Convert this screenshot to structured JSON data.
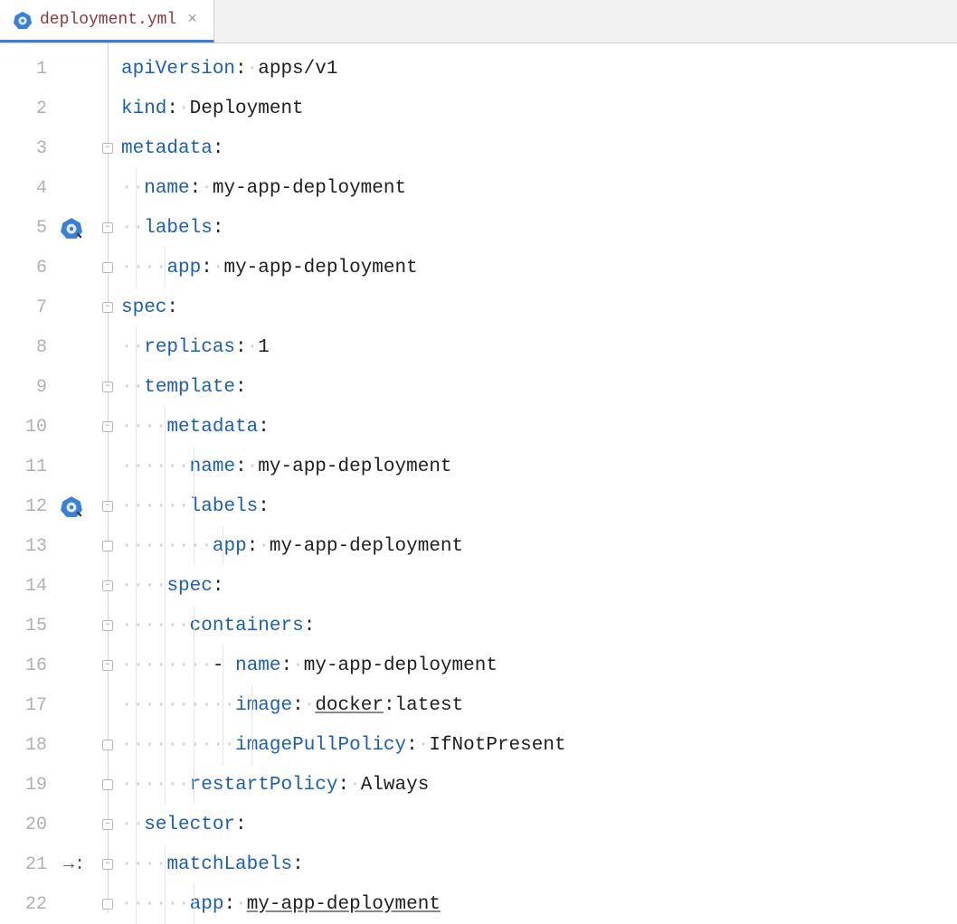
{
  "tab": {
    "filename": "deployment.yml",
    "icon": "kubernetes-icon",
    "close_glyph": "×"
  },
  "gutter": {
    "k8s_marker_lines": [
      5,
      12
    ],
    "arrow_marker_line": 21
  },
  "code_lines": [
    {
      "n": 1,
      "indent": 0,
      "fold": null,
      "seg": [
        [
          "apiVersion",
          "k"
        ],
        [
          ": ",
          "p"
        ],
        [
          "apps/v1",
          "v"
        ]
      ]
    },
    {
      "n": 2,
      "indent": 0,
      "fold": null,
      "seg": [
        [
          "kind",
          "k"
        ],
        [
          ": ",
          "p"
        ],
        [
          "Deployment",
          "v"
        ]
      ]
    },
    {
      "n": 3,
      "indent": 0,
      "fold": "open",
      "seg": [
        [
          "metadata",
          "k"
        ],
        [
          ":",
          "p"
        ]
      ]
    },
    {
      "n": 4,
      "indent": 1,
      "fold": null,
      "seg": [
        [
          "name",
          "k"
        ],
        [
          ": ",
          "p"
        ],
        [
          "my-app-deployment",
          "v"
        ]
      ]
    },
    {
      "n": 5,
      "indent": 1,
      "fold": "open",
      "seg": [
        [
          "labels",
          "k"
        ],
        [
          ":",
          "p"
        ]
      ]
    },
    {
      "n": 6,
      "indent": 2,
      "fold": "end",
      "seg": [
        [
          "app",
          "k"
        ],
        [
          ": ",
          "p"
        ],
        [
          "my-app-deployment",
          "v"
        ]
      ]
    },
    {
      "n": 7,
      "indent": 0,
      "fold": "open",
      "seg": [
        [
          "spec",
          "k"
        ],
        [
          ":",
          "p"
        ]
      ]
    },
    {
      "n": 8,
      "indent": 1,
      "fold": null,
      "seg": [
        [
          "replicas",
          "k"
        ],
        [
          ": ",
          "p"
        ],
        [
          "1",
          "v"
        ]
      ]
    },
    {
      "n": 9,
      "indent": 1,
      "fold": "open",
      "seg": [
        [
          "template",
          "k"
        ],
        [
          ":",
          "p"
        ]
      ]
    },
    {
      "n": 10,
      "indent": 2,
      "fold": "open",
      "seg": [
        [
          "metadata",
          "k"
        ],
        [
          ":",
          "p"
        ]
      ]
    },
    {
      "n": 11,
      "indent": 3,
      "fold": null,
      "seg": [
        [
          "name",
          "k"
        ],
        [
          ": ",
          "p"
        ],
        [
          "my-app-deployment",
          "v"
        ]
      ]
    },
    {
      "n": 12,
      "indent": 3,
      "fold": "open",
      "seg": [
        [
          "labels",
          "k"
        ],
        [
          ":",
          "p"
        ]
      ]
    },
    {
      "n": 13,
      "indent": 4,
      "fold": "end",
      "seg": [
        [
          "app",
          "k"
        ],
        [
          ": ",
          "p"
        ],
        [
          "my-app-deployment",
          "v"
        ]
      ]
    },
    {
      "n": 14,
      "indent": 2,
      "fold": "open",
      "seg": [
        [
          "spec",
          "k"
        ],
        [
          ":",
          "p"
        ]
      ]
    },
    {
      "n": 15,
      "indent": 3,
      "fold": "open",
      "seg": [
        [
          "containers",
          "k"
        ],
        [
          ":",
          "p"
        ]
      ]
    },
    {
      "n": 16,
      "indent": 4,
      "fold": "open",
      "dash": true,
      "seg": [
        [
          "name",
          "k"
        ],
        [
          ": ",
          "p"
        ],
        [
          "my-app-deployment",
          "v"
        ]
      ]
    },
    {
      "n": 17,
      "indent": 5,
      "fold": null,
      "seg": [
        [
          "image",
          "k"
        ],
        [
          ": ",
          "p"
        ],
        [
          "docker",
          "vu"
        ],
        [
          ":latest",
          "v"
        ]
      ]
    },
    {
      "n": 18,
      "indent": 5,
      "fold": "end",
      "seg": [
        [
          "imagePullPolicy",
          "k"
        ],
        [
          ": ",
          "p"
        ],
        [
          "IfNotPresent",
          "v"
        ]
      ]
    },
    {
      "n": 19,
      "indent": 3,
      "fold": "end",
      "seg": [
        [
          "restartPolicy",
          "k"
        ],
        [
          ": ",
          "p"
        ],
        [
          "Always",
          "v"
        ]
      ]
    },
    {
      "n": 20,
      "indent": 1,
      "fold": "open",
      "seg": [
        [
          "selector",
          "k"
        ],
        [
          ":",
          "p"
        ]
      ]
    },
    {
      "n": 21,
      "indent": 2,
      "fold": "open",
      "seg": [
        [
          "matchLabels",
          "k"
        ],
        [
          ":",
          "p"
        ]
      ]
    },
    {
      "n": 22,
      "indent": 3,
      "fold": "end",
      "seg": [
        [
          "app",
          "k"
        ],
        [
          ": ",
          "p"
        ],
        [
          "my-app-deployment",
          "vu"
        ]
      ]
    }
  ]
}
